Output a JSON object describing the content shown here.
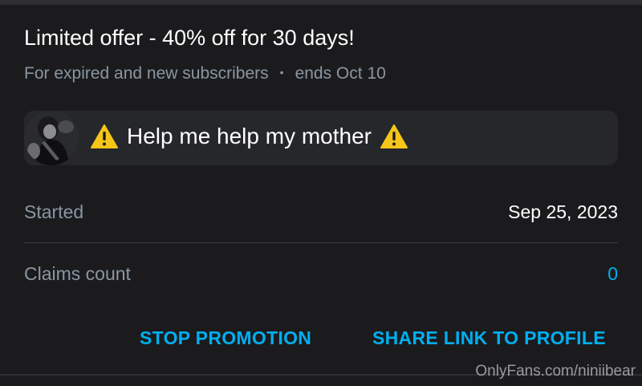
{
  "promotion": {
    "title": "Limited offer - 40% off for 30 days!",
    "audience": "For expired and new subscribers",
    "separator": "•",
    "ends": "ends Oct 10"
  },
  "message": {
    "text": "Help me help my mother",
    "leading_icon": "warning-icon",
    "trailing_icon": "warning-icon"
  },
  "details": {
    "started_label": "Started",
    "started_value": "Sep 25, 2023",
    "claims_label": "Claims count",
    "claims_value": "0"
  },
  "actions": {
    "stop_label": "STOP PROMOTION",
    "share_label": "SHARE LINK TO PROFILE"
  },
  "watermark": "OnlyFans.com/niniibear",
  "colors": {
    "background": "#1b1b1d",
    "card": "#25272b",
    "accent": "#00aff0",
    "muted_text": "#8a96a3",
    "warning": "#f5c518"
  }
}
